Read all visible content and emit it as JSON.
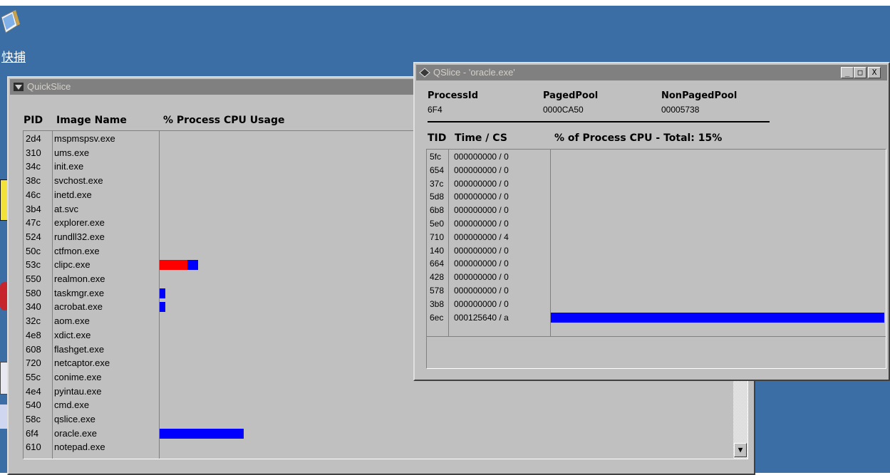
{
  "desktop": {
    "label": "快捕",
    "accent": "#3a6ea5"
  },
  "quickslice": {
    "title": "QuickSlice",
    "headers": {
      "pid": "PID",
      "image": "Image Name",
      "cpu": "% Process CPU Usage"
    },
    "processes": [
      {
        "pid": "2d4",
        "image": "mspmspsv.exe"
      },
      {
        "pid": "310",
        "image": "ums.exe"
      },
      {
        "pid": "34c",
        "image": "init.exe"
      },
      {
        "pid": "38c",
        "image": "svchost.exe"
      },
      {
        "pid": "46c",
        "image": "inetd.exe"
      },
      {
        "pid": "3b4",
        "image": "at.svc"
      },
      {
        "pid": "47c",
        "image": "explorer.exe"
      },
      {
        "pid": "524",
        "image": "rundll32.exe"
      },
      {
        "pid": "50c",
        "image": "ctfmon.exe"
      },
      {
        "pid": "53c",
        "image": "clipc.exe"
      },
      {
        "pid": "550",
        "image": "realmon.exe"
      },
      {
        "pid": "580",
        "image": "taskmgr.exe"
      },
      {
        "pid": "340",
        "image": "acrobat.exe"
      },
      {
        "pid": "32c",
        "image": "aom.exe"
      },
      {
        "pid": "4e8",
        "image": "xdict.exe"
      },
      {
        "pid": "608",
        "image": "flashget.exe"
      },
      {
        "pid": "720",
        "image": "netcaptor.exe"
      },
      {
        "pid": "55c",
        "image": "conime.exe"
      },
      {
        "pid": "4e4",
        "image": "pyintau.exe"
      },
      {
        "pid": "540",
        "image": "cmd.exe"
      },
      {
        "pid": "58c",
        "image": "qslice.exe"
      },
      {
        "pid": "6f4",
        "image": "oracle.exe"
      },
      {
        "pid": "610",
        "image": "notepad.exe"
      }
    ],
    "cpu_bars": [
      {
        "row": 9,
        "kernel_fraction": 0.049,
        "user_fraction": 0.019
      },
      {
        "row": 11,
        "kernel_fraction": 0,
        "user_fraction": 0.01
      },
      {
        "row": 12,
        "kernel_fraction": 0,
        "user_fraction": 0.01
      },
      {
        "row": 21,
        "kernel_fraction": 0,
        "user_fraction": 0.149
      }
    ],
    "bar_colors": {
      "kernel": "#ff0000",
      "user": "#0000ff"
    },
    "scroll_down_glyph": "▼"
  },
  "qslice_oracle": {
    "title": "QSlice - 'oracle.exe'",
    "controls": {
      "minimize": "_",
      "maximize": "□",
      "close": "X"
    },
    "info": {
      "process_id_label": "ProcessId",
      "process_id_value": "6F4",
      "paged_pool_label": "PagedPool",
      "paged_pool_value": "0000CA50",
      "nonpaged_pool_label": "NonPagedPool",
      "nonpaged_pool_value": "00005738"
    },
    "headers": {
      "tid": "TID",
      "time": "Time / CS",
      "cpu": "% of Process CPU - Total: 15%"
    },
    "threads": [
      {
        "tid": "5fc",
        "time": "000000000  / 0"
      },
      {
        "tid": "654",
        "time": "000000000  / 0"
      },
      {
        "tid": "37c",
        "time": "000000000  / 0"
      },
      {
        "tid": "5d8",
        "time": "000000000  / 0"
      },
      {
        "tid": "6b8",
        "time": "000000000  / 0"
      },
      {
        "tid": "5e0",
        "time": "000000000  / 0"
      },
      {
        "tid": "710",
        "time": "000000000  / 4"
      },
      {
        "tid": "140",
        "time": "000000000  / 0"
      },
      {
        "tid": "664",
        "time": "000000000  / 0"
      },
      {
        "tid": "428",
        "time": "000000000  / 0"
      },
      {
        "tid": "578",
        "time": "000000000  / 0"
      },
      {
        "tid": "3b8",
        "time": "000000000  / 0"
      },
      {
        "tid": "6ec",
        "time": "000125640  / a"
      }
    ],
    "thread_bars": [
      {
        "row": 12,
        "user_fraction": 1.0
      }
    ]
  }
}
